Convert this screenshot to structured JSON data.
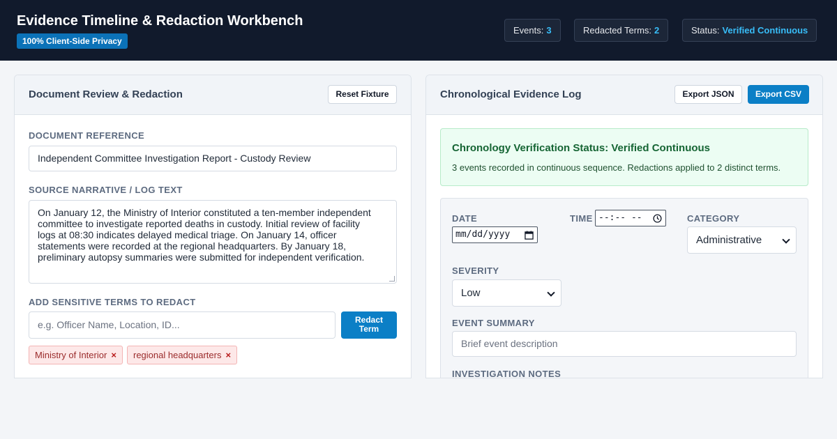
{
  "header": {
    "title": "Evidence Timeline & Redaction Workbench",
    "badge": "100% Client-Side Privacy",
    "stats": [
      {
        "label": "Events:",
        "value": "3"
      },
      {
        "label": "Redacted Terms:",
        "value": "2"
      },
      {
        "label": "Status:",
        "value": "Verified Continuous"
      }
    ],
    "accent_color": "#38bdf8"
  },
  "left_panel": {
    "title": "Document Review & Redaction",
    "reset_label": "Reset Fixture",
    "doc_ref_label": "DOCUMENT REFERENCE",
    "doc_ref_value": "Independent Committee Investigation Report - Custody Review",
    "narrative_label": "SOURCE NARRATIVE / LOG TEXT",
    "narrative_lines": [
      "On January 12, the Ministry of Interior constituted a ten-member independent",
      "committee to investigate reported deaths in custody. Initial review of facility",
      "logs at 08:30 indicates delayed medical triage. On January 14, officer",
      "statements were recorded at the regional headquarters. By January 18,",
      "preliminary autopsy summaries were submitted for independent verification."
    ],
    "terms_label": "ADD SENSITIVE TERMS TO REDACT",
    "terms_placeholder": "e.g. Officer Name, Location, ID...",
    "redact_button_line1": "Redact",
    "redact_button_line2": "Term",
    "redacted_terms": [
      "Ministry of Interior",
      "regional headquarters"
    ],
    "remove_glyph": "×"
  },
  "right_panel": {
    "title": "Chronological Evidence Log",
    "export_json_label": "Export JSON",
    "export_csv_label": "Export CSV",
    "verify_title": "Chronology Verification Status: Verified Continuous",
    "verify_desc": "3 events recorded in continuous sequence. Redactions applied to 2 distinct terms.",
    "form": {
      "date_label": "DATE",
      "date_value": "mm/dd/yyyy",
      "time_label": "TIME",
      "time_value": "--:-- --",
      "category_label": "CATEGORY",
      "category_value": "Administrative",
      "severity_label": "SEVERITY",
      "severity_value": "Low",
      "summary_label": "EVENT SUMMARY",
      "summary_placeholder": "Brief event description",
      "notes_label": "INVESTIGATION NOTES"
    }
  }
}
